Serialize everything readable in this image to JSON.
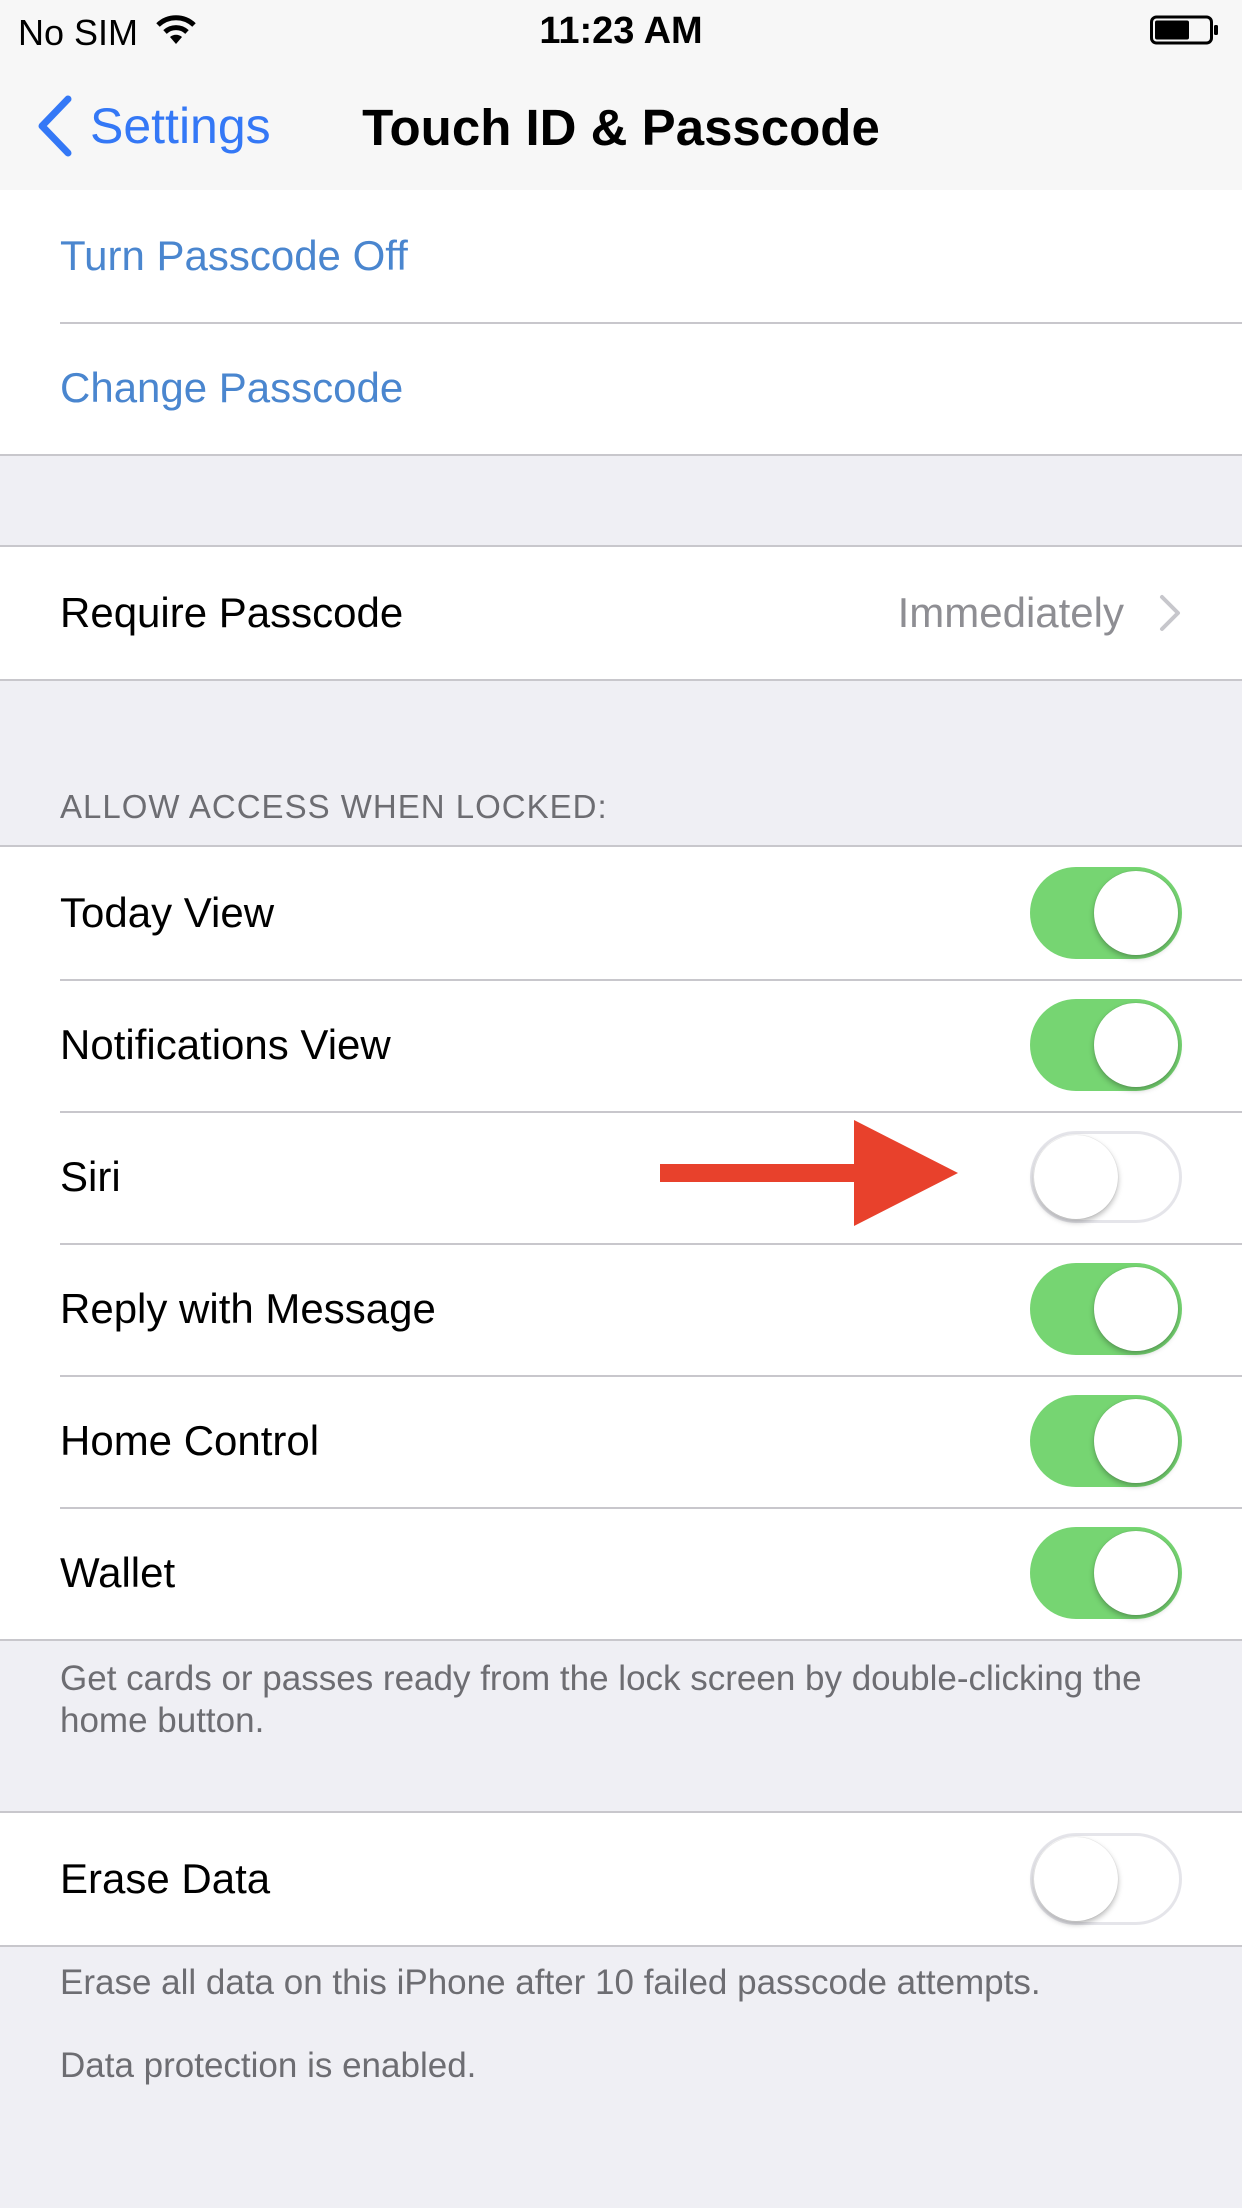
{
  "status_bar": {
    "carrier": "No SIM",
    "time": "11:23 AM"
  },
  "nav": {
    "back_label": "Settings",
    "title": "Touch ID & Passcode"
  },
  "passcode_actions": [
    {
      "label": "Turn Passcode Off"
    },
    {
      "label": "Change Passcode"
    }
  ],
  "require_passcode": {
    "label": "Require Passcode",
    "value": "Immediately"
  },
  "allow_access": {
    "header": "ALLOW ACCESS WHEN LOCKED:",
    "items": [
      {
        "label": "Today View",
        "on": true
      },
      {
        "label": "Notifications View",
        "on": true
      },
      {
        "label": "Siri",
        "on": false
      },
      {
        "label": "Reply with Message",
        "on": true
      },
      {
        "label": "Home Control",
        "on": true
      },
      {
        "label": "Wallet",
        "on": true
      }
    ],
    "footer": "Get cards or passes ready from the lock screen by double-clicking the home button."
  },
  "erase_data": {
    "label": "Erase Data",
    "on": false,
    "footer_1": "Erase all data on this iPhone after 10 failed passcode attempts.",
    "footer_2": "Data protection is enabled."
  },
  "colors": {
    "accent": "#3478f6",
    "link": "#4a86cf",
    "toggle_on": "#76d572",
    "annotation_arrow": "#e8412c"
  }
}
